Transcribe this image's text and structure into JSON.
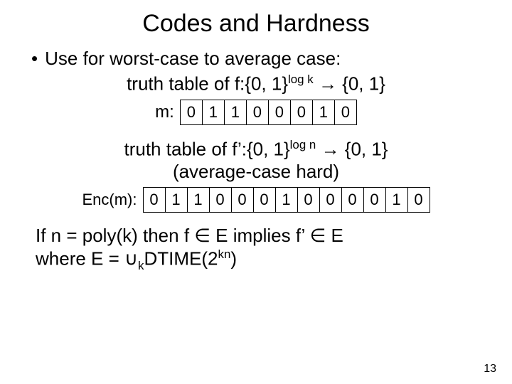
{
  "title": "Codes and Hardness",
  "bullet1": "Use for worst-case to average case:",
  "line_truth_f_prefix": "truth table of f:{0, 1}",
  "line_truth_f_exp": "log k",
  "line_truth_f_suffix": " → {0, 1}",
  "m_label": "m:",
  "m_bits": [
    "0",
    "1",
    "1",
    "0",
    "0",
    "0",
    "1",
    "0"
  ],
  "line_truth_fp_prefix": "truth table of f’:{0, 1}",
  "line_truth_fp_exp": "log n",
  "line_truth_fp_suffix": " → {0, 1}",
  "remark": "(average-case hard)",
  "enc_label": "Enc(m):",
  "enc_bits": [
    "0",
    "1",
    "1",
    "0",
    "0",
    "0",
    "1",
    "0",
    "0",
    "0",
    "0",
    "1",
    "0"
  ],
  "concl_l1_a": "If n = poly(k) then f ",
  "concl_l1_mid": " E implies f’ ",
  "concl_l1_end": " E",
  "concl_l2_a": "where E = ",
  "concl_l2_mid": "DTIME(2",
  "concl_l2_end": ")",
  "concl_sub_k": "k",
  "concl_exp_kn": "kn",
  "pagenum": "13"
}
